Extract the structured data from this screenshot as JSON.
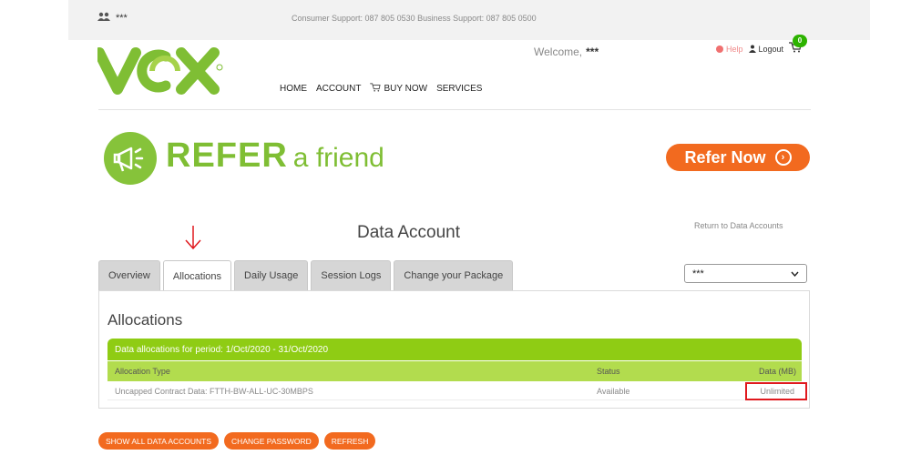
{
  "topbar": {
    "username": "***",
    "support_text": "Consumer Support: 087 805 0530   Business Support: 087 805 0500"
  },
  "brand": {
    "logo_text": "VOX",
    "accent_green": "#7fbe34",
    "accent_orange": "#f26a1f"
  },
  "header": {
    "welcome_label": "Welcome,",
    "welcome_name": "***",
    "help_label": "Help",
    "logout_label": "Logout",
    "cart_count": "0"
  },
  "nav": {
    "home": "HOME",
    "account": "ACCOUNT",
    "buy_now": "BUY NOW",
    "services": "SERVICES"
  },
  "banner": {
    "refer": "REFER",
    "a_friend": "a friend",
    "button": "Refer Now"
  },
  "page": {
    "title": "Data Account",
    "return_link": "Return to Data Accounts"
  },
  "tabs": [
    {
      "label": "Overview"
    },
    {
      "label": "Allocations"
    },
    {
      "label": "Daily Usage"
    },
    {
      "label": "Session Logs"
    },
    {
      "label": "Change your Package"
    }
  ],
  "account_select": {
    "value": "***"
  },
  "allocations": {
    "title": "Allocations",
    "period_label": "Data allocations for period: 1/Oct/2020 - 31/Oct/2020",
    "columns": {
      "type": "Allocation Type",
      "status": "Status",
      "data": "Data (MB)"
    },
    "rows": [
      {
        "type": "Uncapped Contract Data: FTTH-BW-ALL-UC-30MBPS",
        "status": "Available",
        "data": "Unlimited"
      }
    ]
  },
  "actions": {
    "show_all": "SHOW ALL DATA ACCOUNTS",
    "change_password": "CHANGE PASSWORD",
    "refresh": "REFRESH"
  }
}
